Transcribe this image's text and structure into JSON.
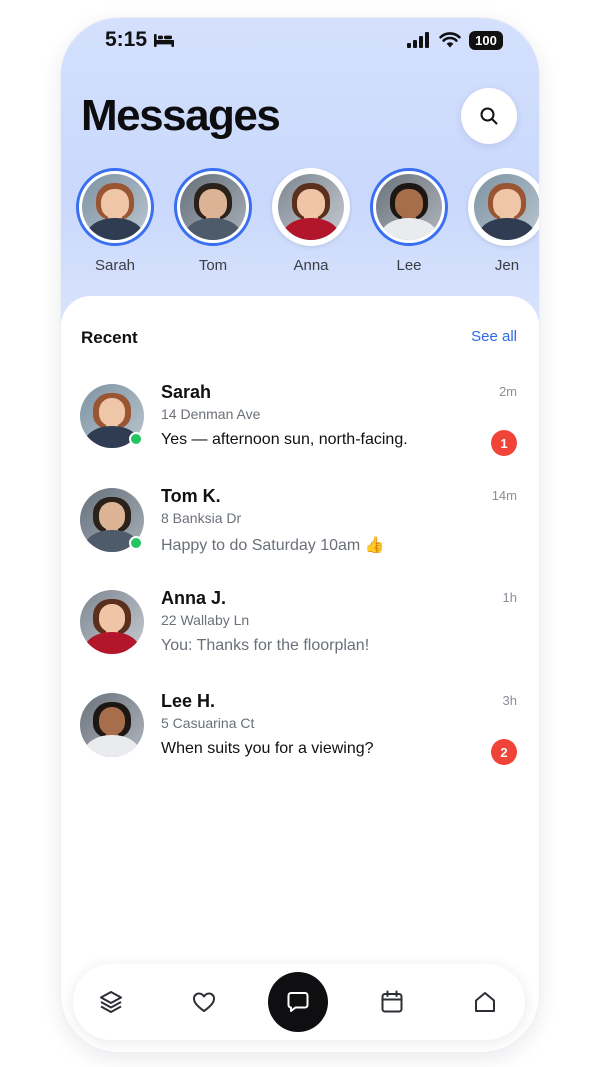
{
  "status_bar": {
    "time": "5:15",
    "battery": "100"
  },
  "header": {
    "title": "Messages"
  },
  "stories": [
    {
      "name": "Sarah",
      "unseen": true,
      "avatar": "sarah"
    },
    {
      "name": "Tom",
      "unseen": true,
      "avatar": "tom"
    },
    {
      "name": "Anna",
      "unseen": false,
      "avatar": "anna"
    },
    {
      "name": "Lee",
      "unseen": true,
      "avatar": "lee"
    },
    {
      "name": "Jen",
      "unseen": false,
      "avatar": "sarah"
    }
  ],
  "recent": {
    "label": "Recent",
    "see_all": "See all",
    "conversations": [
      {
        "name": "Sarah",
        "address": "14 Denman Ave",
        "preview": "Yes — afternoon sun, north-facing.",
        "time": "2m",
        "unread": "1",
        "online": true,
        "avatar": "sarah"
      },
      {
        "name": "Tom K.",
        "address": "8 Banksia Dr",
        "preview": "Happy to do Saturday 10am 👍",
        "time": "14m",
        "unread": "",
        "online": true,
        "avatar": "tom"
      },
      {
        "name": "Anna J.",
        "address": "22 Wallaby Ln",
        "preview": "You: Thanks for the floorplan!",
        "time": "1h",
        "unread": "",
        "online": false,
        "avatar": "anna"
      },
      {
        "name": "Lee H.",
        "address": "5 Casuarina Ct",
        "preview": "When suits you for a viewing?",
        "time": "3h",
        "unread": "2",
        "online": false,
        "avatar": "lee"
      }
    ]
  },
  "bottom_nav": {
    "items": [
      {
        "icon": "layers-icon",
        "active": false
      },
      {
        "icon": "heart-icon",
        "active": false
      },
      {
        "icon": "chat-icon",
        "active": true
      },
      {
        "icon": "calendar-icon",
        "active": false
      },
      {
        "icon": "home-icon",
        "active": false
      }
    ]
  },
  "colors": {
    "accent": "#2f6ae6",
    "story_ring": "#3a6ff0",
    "badge": "#f04438",
    "online": "#22c55e"
  }
}
